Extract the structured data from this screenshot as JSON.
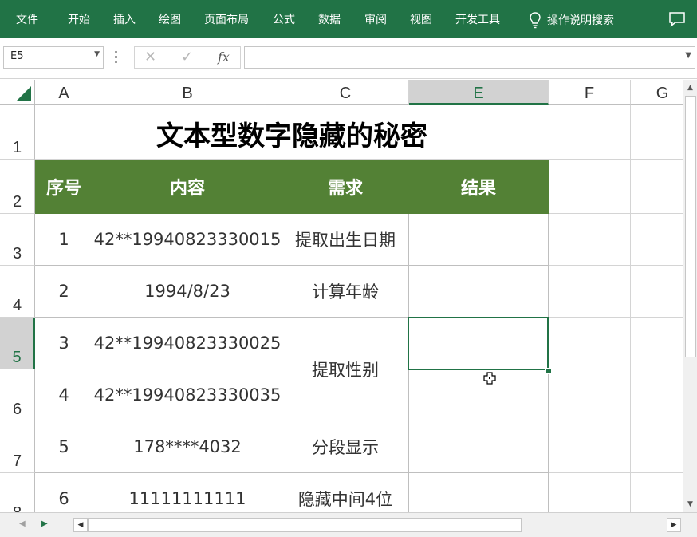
{
  "ribbon": {
    "tabs": [
      "文件",
      "开始",
      "插入",
      "绘图",
      "页面布局",
      "公式",
      "数据",
      "审阅",
      "视图",
      "开发工具"
    ],
    "tell_me": "操作说明搜索",
    "tell_me_icon": "lightbulb-icon",
    "comment_icon": "comment-icon",
    "color": "#217346"
  },
  "formula_bar": {
    "name_box": "E5",
    "cancel_icon": "✕",
    "enter_icon": "✓",
    "fx_label": "fx",
    "formula": ""
  },
  "grid": {
    "columns": [
      "A",
      "B",
      "C",
      "E",
      "F",
      "G"
    ],
    "selected_column": "E",
    "rows": [
      "1",
      "2",
      "3",
      "4",
      "5",
      "6",
      "7",
      "8"
    ],
    "selected_row": "5"
  },
  "sheet": {
    "title": "文本型数字隐藏的秘密",
    "headers": [
      "序号",
      "内容",
      "需求",
      "结果"
    ],
    "header_color": "#538135",
    "data": [
      {
        "no": "1",
        "content": "42**19940823330015",
        "need": "提取出生日期",
        "result": ""
      },
      {
        "no": "2",
        "content": "1994/8/23",
        "need": "计算年龄",
        "result": ""
      },
      {
        "no": "3",
        "content": "42**19940823330025",
        "need": "提取性别",
        "result": ""
      },
      {
        "no": "4",
        "content": "42**19940823330035",
        "need": "",
        "result": ""
      },
      {
        "no": "5",
        "content": "178****4032",
        "need": "分段显示",
        "result": ""
      },
      {
        "no": "6",
        "content": "11111111111",
        "need": "隐藏中间4位",
        "result": ""
      }
    ]
  }
}
